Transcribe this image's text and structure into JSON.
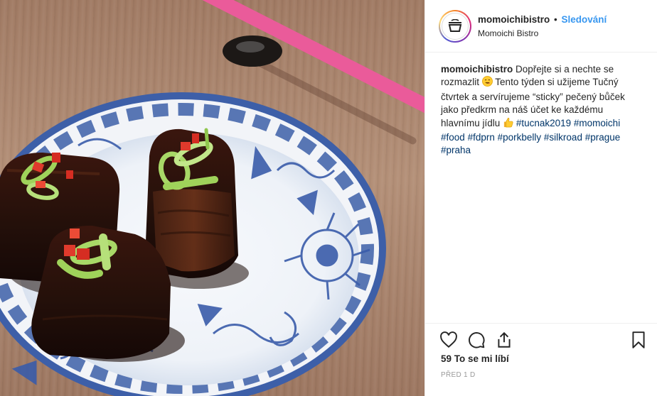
{
  "post": {
    "image_alt": "pork belly",
    "header": {
      "username": "momoichibistro",
      "separator": "•",
      "follow_label": "Sledování",
      "location": "Momoichi Bistro",
      "avatar_icon": "basket-logo-icon"
    },
    "caption": {
      "username": "momoichibistro",
      "text_part1": "Dopřejte si a nechte se rozmazlit",
      "emoji1": "yum-face-emoji",
      "text_part2": "Tento týden si užijeme Tučný čtvrtek a servírujeme “sticky” pečený bůček jako předkrm na náš účet ke každému hlavnímu jídlu",
      "emoji2": "thumbs-up-emoji",
      "hashtags": [
        "#tucnak2019",
        "#momoichi",
        "#food",
        "#fdprn",
        "#porkbelly",
        "#silkroad",
        "#prague",
        "#praha"
      ]
    },
    "actions": {
      "like_icon": "heart-icon",
      "comment_icon": "comment-icon",
      "share_icon": "share-icon",
      "save_icon": "bookmark-icon"
    },
    "likes_text": "59 To se mi líbí",
    "timestamp": "PŘED 1 D",
    "colors": {
      "follow": "#3897f0",
      "hashtag": "#003569",
      "timestamp": "#999999"
    }
  }
}
